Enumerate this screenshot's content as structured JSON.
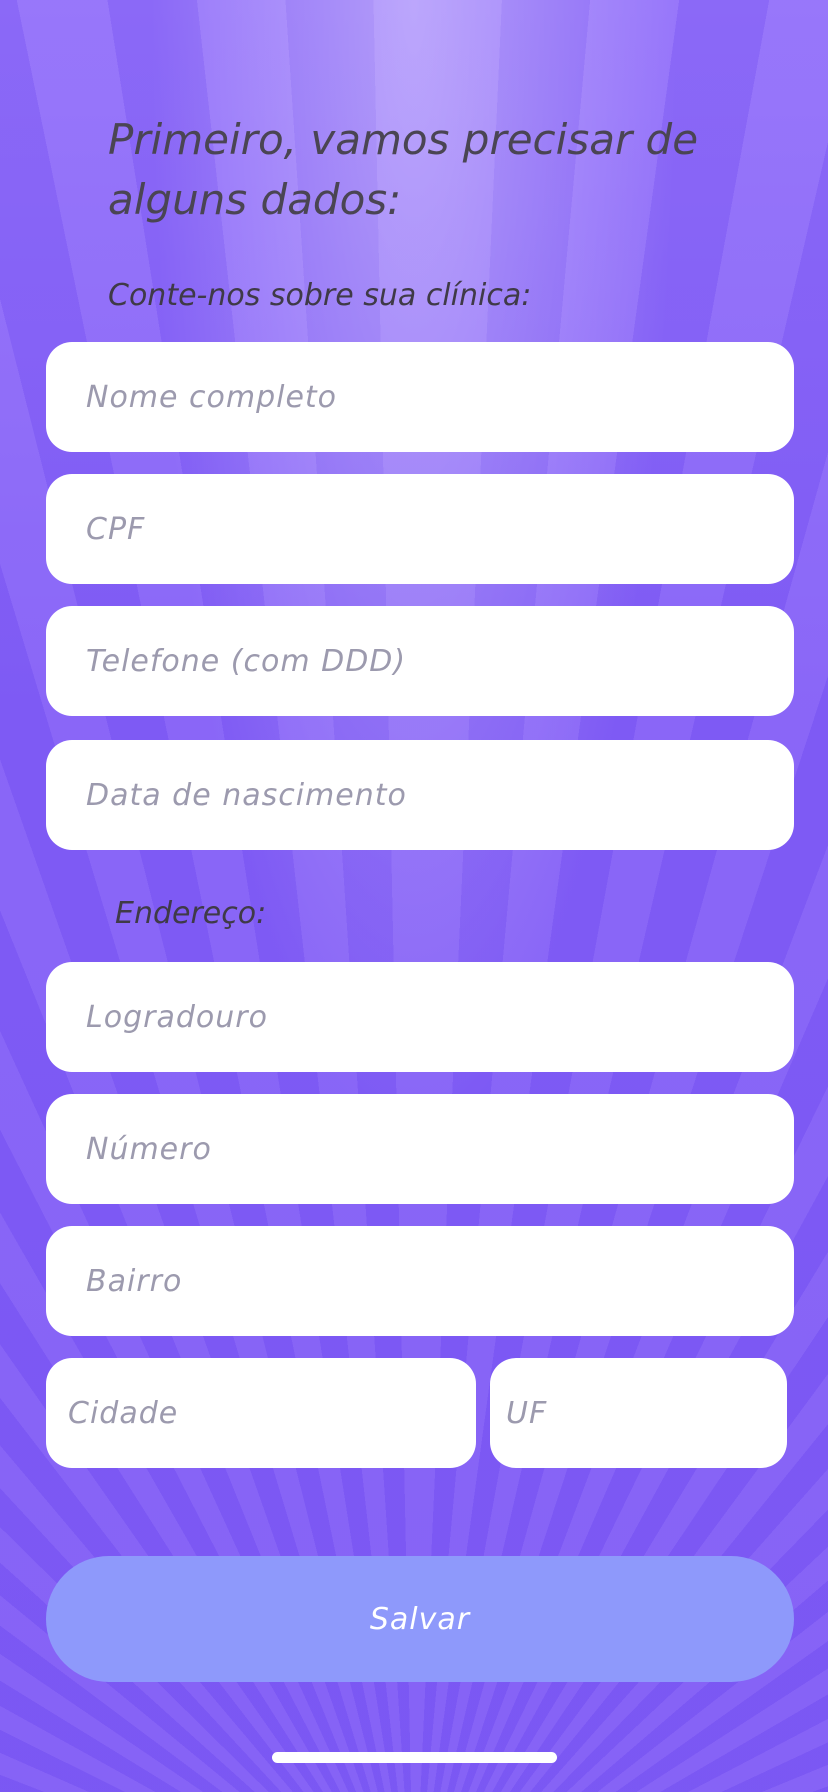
{
  "header": {
    "title": "Primeiro, vamos precisar de alguns dados:"
  },
  "clinic_section": {
    "label": "Conte-nos sobre sua clínica:",
    "fields": {
      "full_name": {
        "placeholder": "Nome completo",
        "value": ""
      },
      "cpf": {
        "placeholder": "CPF",
        "value": ""
      },
      "phone": {
        "placeholder": "Telefone (com DDD)",
        "value": ""
      },
      "birth_date": {
        "placeholder": "Data de nascimento",
        "value": ""
      }
    }
  },
  "address_section": {
    "label": "Endereço:",
    "fields": {
      "street": {
        "placeholder": "Logradouro",
        "value": ""
      },
      "number": {
        "placeholder": "Número",
        "value": ""
      },
      "district": {
        "placeholder": "Bairro",
        "value": ""
      },
      "city": {
        "placeholder": "Cidade",
        "value": ""
      },
      "state": {
        "placeholder": "UF",
        "value": ""
      }
    }
  },
  "actions": {
    "save_label": "Salvar"
  },
  "colors": {
    "background": "#c9b4fb",
    "ray_light": "#d9c9fe",
    "button": "#8e99fb",
    "text_dark": "#4a4553",
    "placeholder": "#9c9aae",
    "field_bg": "#ffffff"
  }
}
